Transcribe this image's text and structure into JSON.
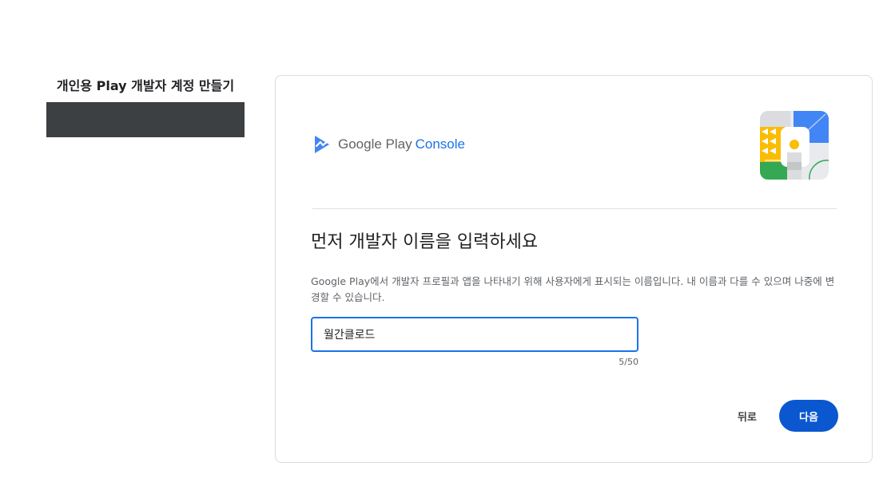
{
  "sidebar": {
    "title": "개인용 Play 개발자 계정 만들기"
  },
  "logo": {
    "google_play": "Google Play",
    "console": "Console"
  },
  "form": {
    "heading": "먼저 개발자 이름을 입력하세요",
    "description": "Google Play에서 개발자 프로필과 앱을 나타내기 위해 사용자에게 표시되는 이름입니다. 내 이름과 다를 수 있으며 나중에 변경할 수 있습니다.",
    "developer_name_value": "월간클로드",
    "char_counter": "5/50"
  },
  "actions": {
    "back_label": "뒤로",
    "next_label": "다음"
  },
  "colors": {
    "accent": "#1a73e8",
    "primary_button": "#0b57d0",
    "sidebar_block": "#3c4043"
  }
}
